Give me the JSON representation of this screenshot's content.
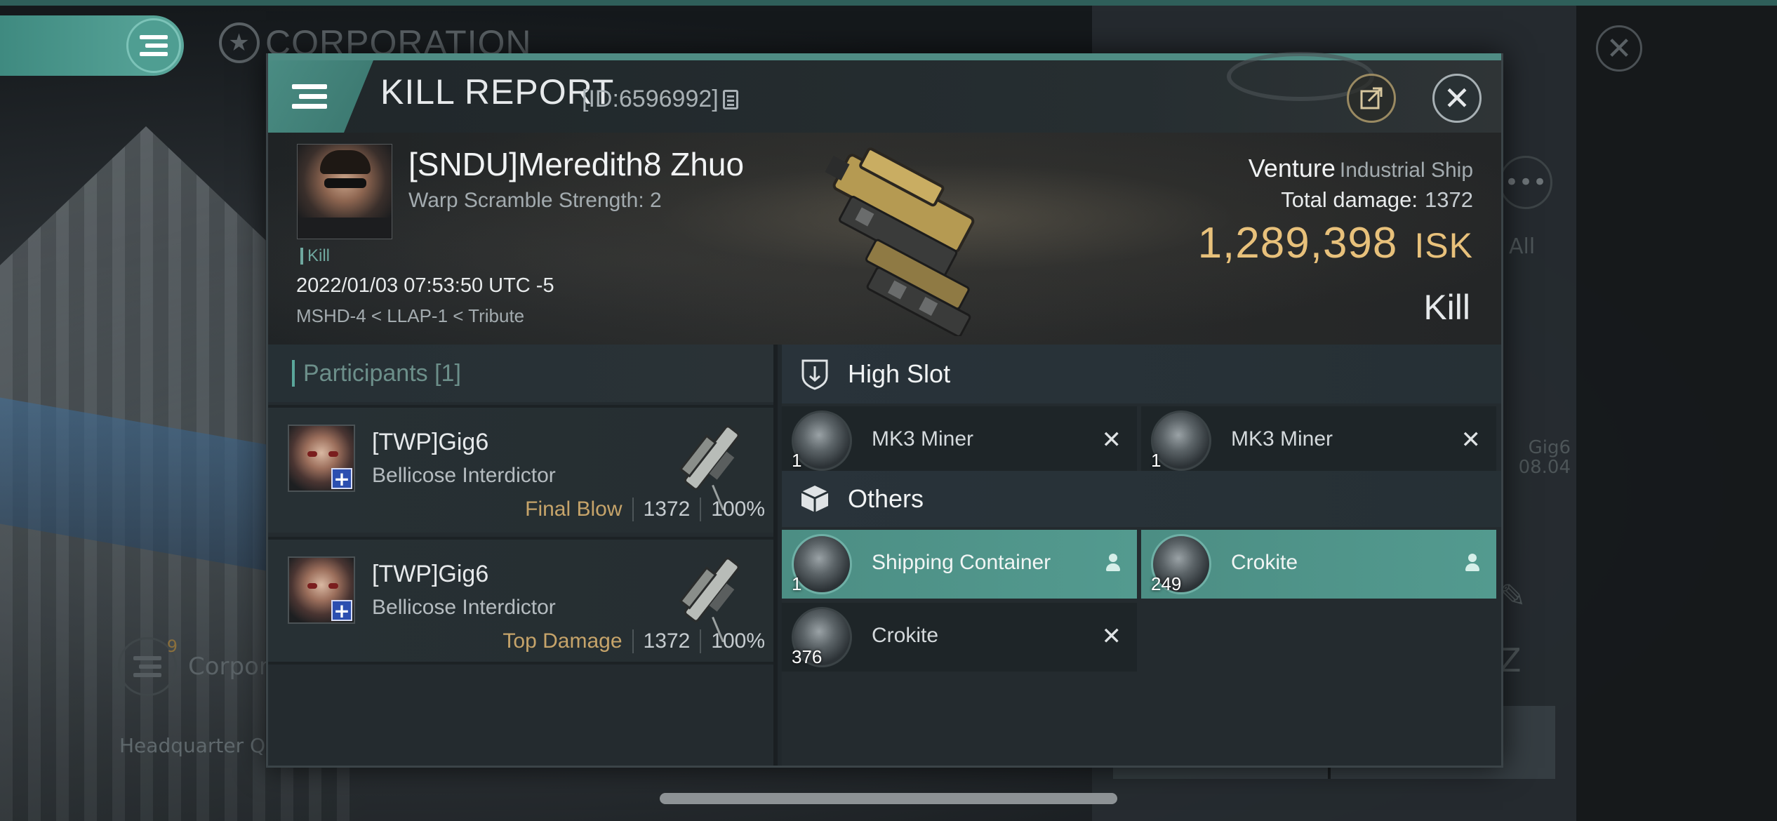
{
  "background": {
    "corporation_title": "CORPORATION",
    "corporation_short": "Corpor",
    "corporation_badge": "9",
    "headquarter_text": "Headquarter Q-T",
    "all_label": "All",
    "side_name": "Gig6",
    "side_date": "08.04"
  },
  "header": {
    "title": "KILL REPORT",
    "id_text": "[ID:6596992]"
  },
  "victim": {
    "name": "[SNDU]Meredith8 Zhuo",
    "warp_scramble": "Warp Scramble Strength: 2",
    "kill_tag": "Kill",
    "timestamp": "2022/01/03 07:53:50 UTC -5",
    "location": "MSHD-4 < LLAP-1 < Tribute",
    "ship_name": "Venture",
    "ship_class": "Industrial Ship",
    "total_damage_label": "Total damage:",
    "total_damage": "1372",
    "isk_value": "1,289,398",
    "isk_currency": "ISK",
    "kill_type": "Kill"
  },
  "participants": {
    "header": "Participants [1]",
    "rows": [
      {
        "name": "[TWP]Gig6",
        "ship": "Bellicose Interdictor",
        "label": "Final Blow",
        "damage": "1372",
        "percent": "100%"
      },
      {
        "name": "[TWP]Gig6",
        "ship": "Bellicose Interdictor",
        "label": "Top Damage",
        "damage": "1372",
        "percent": "100%"
      }
    ]
  },
  "high_slot": {
    "header": "High Slot",
    "items": [
      {
        "name": "MK3 Miner",
        "qty": "1",
        "action": "✕"
      },
      {
        "name": "MK3 Miner",
        "qty": "1",
        "action": "✕"
      }
    ]
  },
  "others": {
    "header": "Others",
    "items": [
      {
        "name": "Shipping Container",
        "qty": "1"
      },
      {
        "name": "Crokite",
        "qty": "249"
      },
      {
        "name": "Crokite",
        "qty": "376",
        "action": "✕"
      }
    ]
  },
  "colors": {
    "accent": "#4f8c84",
    "isk": "#e8c17b",
    "highlight_item": "#4c8e84"
  },
  "icons": [
    "menu-icon",
    "copy-icon",
    "share-icon",
    "close-icon",
    "high-slot-icon",
    "cargo-icon",
    "drop-icon",
    "destroyed-icon"
  ]
}
